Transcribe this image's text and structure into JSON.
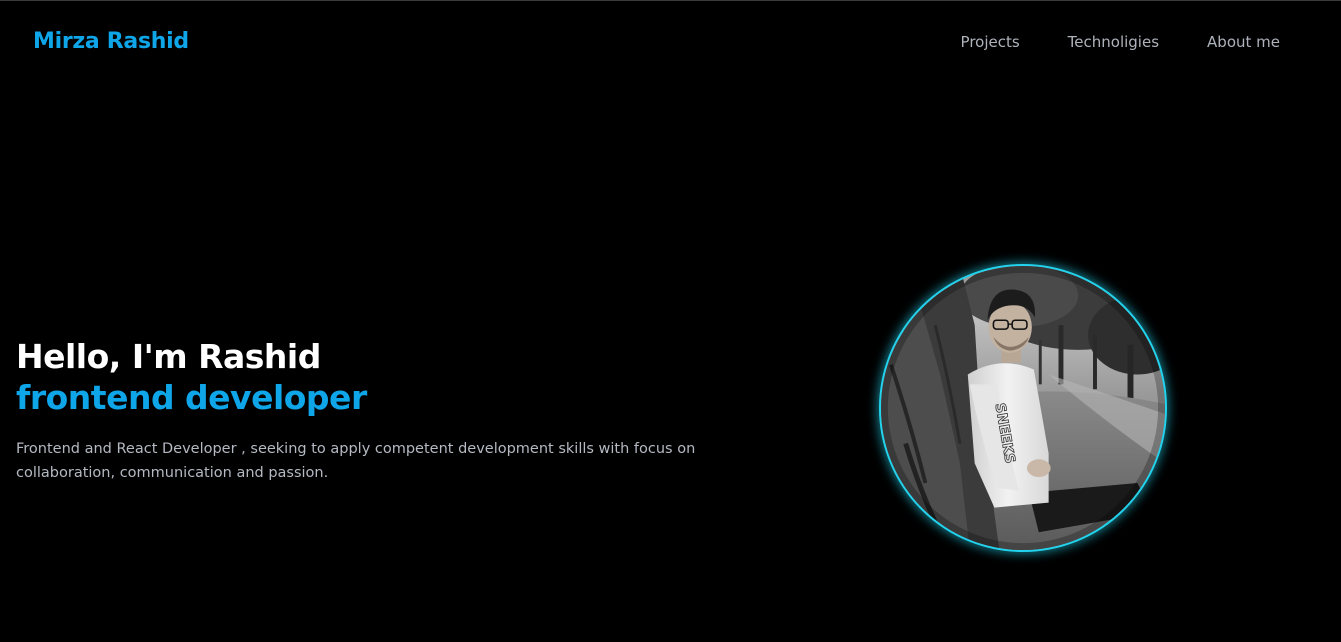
{
  "navbar": {
    "brand": "Mirza Rashid",
    "links": [
      {
        "label": "Projects"
      },
      {
        "label": "Technoligies"
      },
      {
        "label": "About me"
      }
    ]
  },
  "hero": {
    "greeting": "Hello, I'm Rashid",
    "role": "frontend developer",
    "description": "Frontend and React Developer , seeking to apply competent development skills with focus on collaboration, communication and passion.",
    "photo": {
      "hoodie_text": "SNEEKS"
    }
  },
  "colors": {
    "background": "#000000",
    "accent": "#0ea5e9",
    "avatar_ring": "#22d3ee",
    "nav_text": "#aeb3bb",
    "body_text": "#b4b9c2"
  }
}
